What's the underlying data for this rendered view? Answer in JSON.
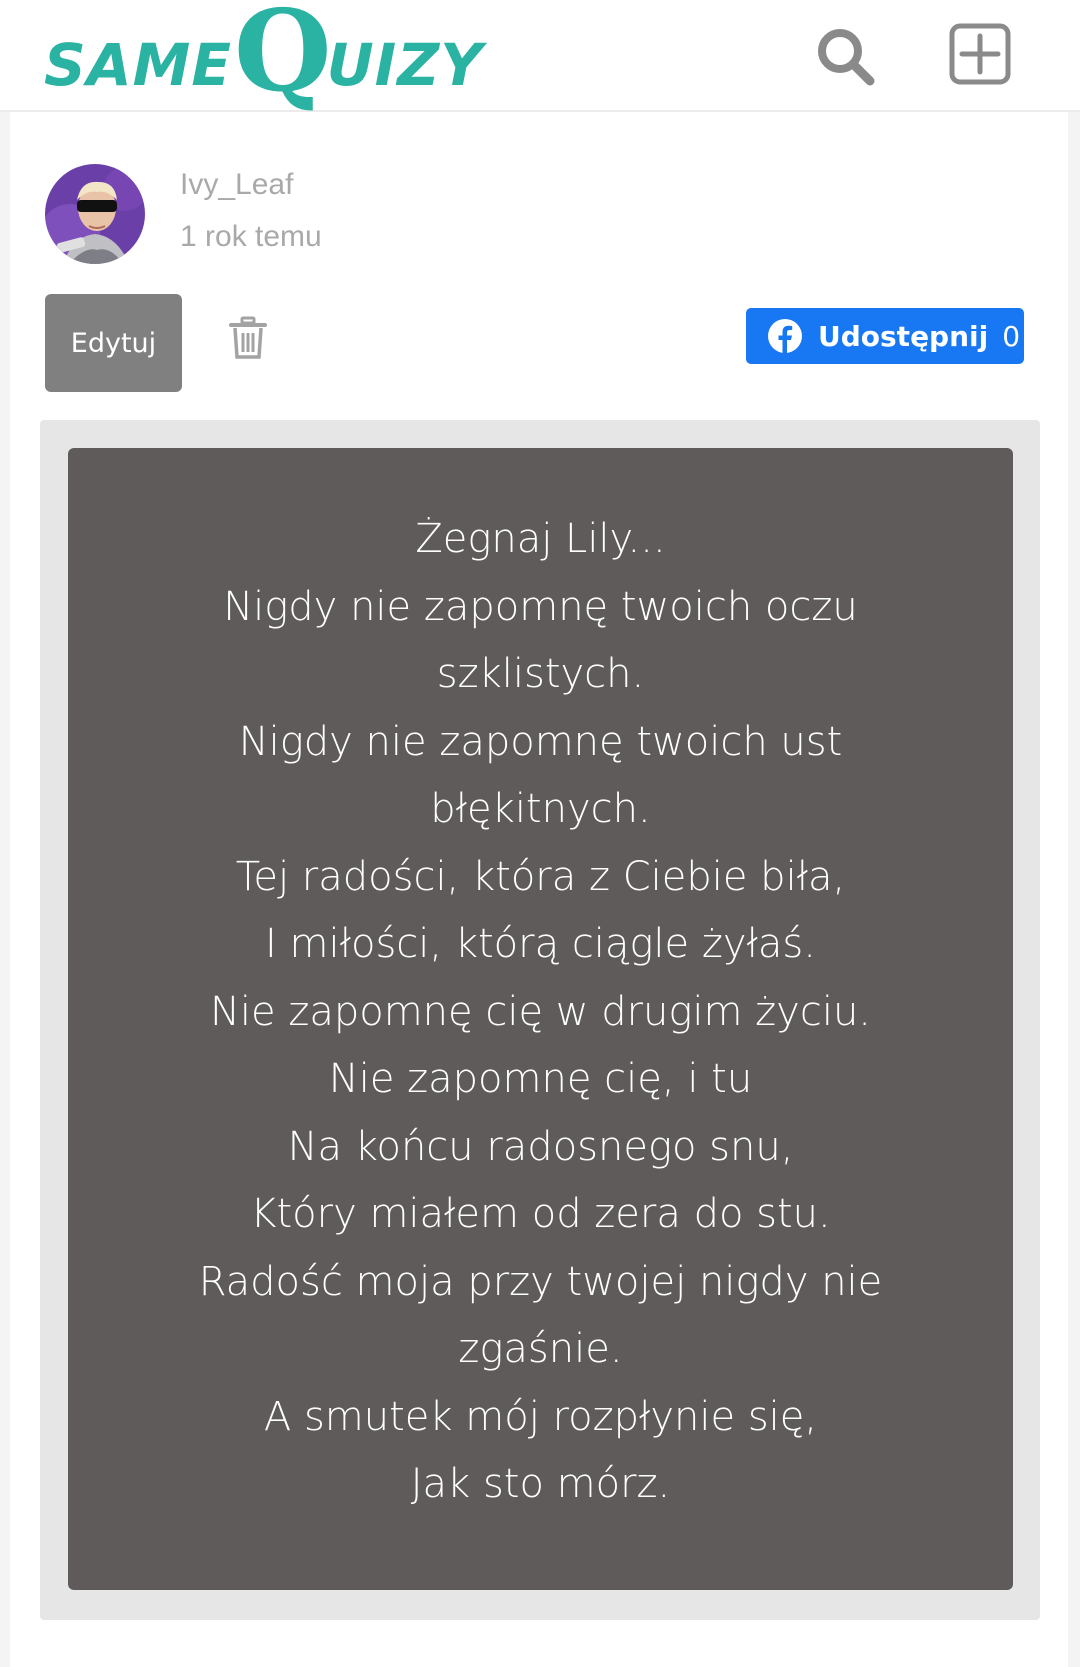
{
  "header": {
    "logo": {
      "part1": "SAME",
      "part2": "Q",
      "part3": "UIZY",
      "color": "#2ab3a3"
    },
    "search_icon": "search-icon",
    "add_icon": "plus-square-icon"
  },
  "post": {
    "author": "Ivy_Leaf",
    "time": "1 rok temu",
    "edit_label": "Edytuj",
    "trash_icon": "trash-icon",
    "share": {
      "label": "Udostępnij",
      "count": "0",
      "icon": "facebook-icon",
      "color": "#1877f2"
    },
    "poem_lines": [
      "Żegnaj Lily...",
      "Nigdy nie zapomnę twoich oczu",
      "szklistych.",
      "Nigdy nie zapomnę twoich ust",
      "błękitnych.",
      "Tej radości, która z Ciebie biła,",
      "I miłości, którą ciągle żyłaś.",
      "Nie zapomnę cię w drugim życiu.",
      "Nie zapomnę cię, i tu",
      "Na końcu radosnego snu,",
      "Który miałem od zera do stu.",
      "Radość moja przy twojej nigdy nie",
      "zgaśnie.",
      "A smutek mój rozpłynie się,",
      "Jak sto mórz."
    ]
  }
}
